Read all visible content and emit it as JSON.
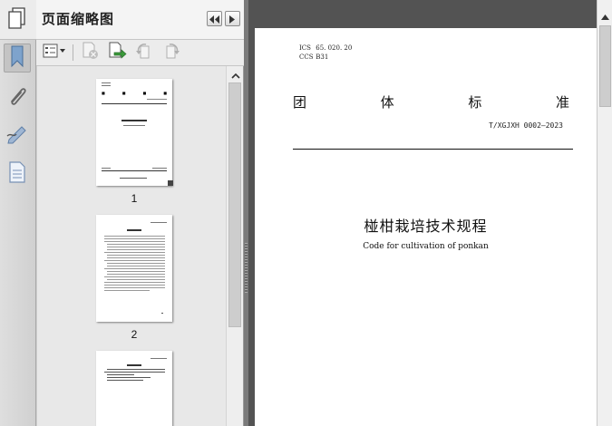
{
  "panel": {
    "title": "页面缩略图",
    "page_labels": [
      "1",
      "2"
    ]
  },
  "icons": {
    "nav_strip": [
      "pages-icon",
      "bookmark-icon",
      "paperclip-icon",
      "signature-icon",
      "layers-page-icon"
    ],
    "panel_header": [
      "collapse-left-icon",
      "expand-right-icon"
    ],
    "toolbar": [
      "thumbnail-options-icon",
      "delete-page-icon",
      "extract-page-icon",
      "rotate-ccw-icon",
      "rotate-cw-icon"
    ]
  },
  "document": {
    "ics_label": "ICS",
    "ics_value": "65. 020. 20",
    "ccs_label": "CCS",
    "ccs_value": "B31",
    "standard_type_chars": [
      "团",
      "体",
      "标",
      "准"
    ],
    "standard_code": "T/XGJXH 0002—2023",
    "title_cn": "椪柑栽培技术规程",
    "title_en": "Code for cultivation of ponkan"
  },
  "colors": {
    "doc_background": "#535353",
    "splitter": "#7a7a7a",
    "panel_background": "#ebebeb",
    "nav_icon_blue": "#5f86b3"
  }
}
